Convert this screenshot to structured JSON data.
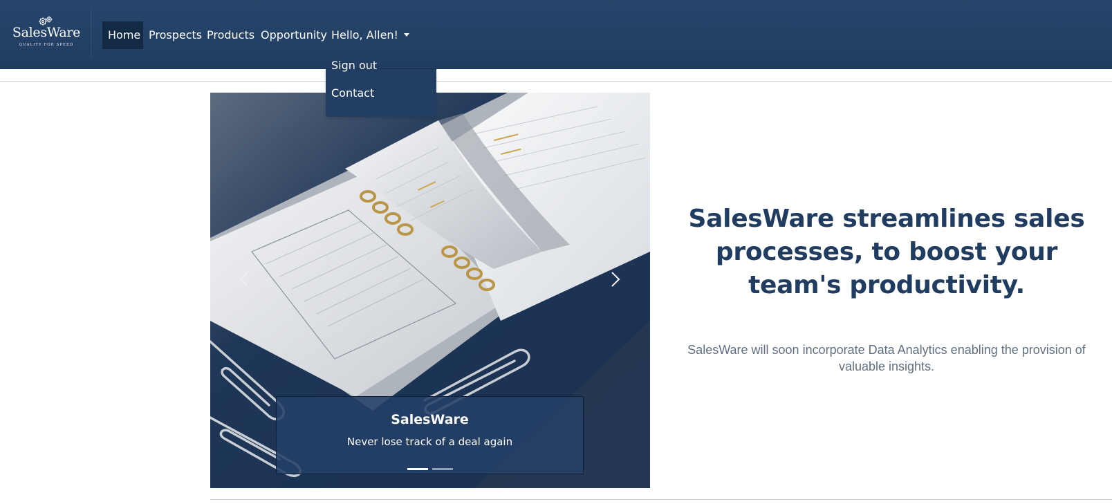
{
  "brand": {
    "name": "SalesWare",
    "tagline": "QUALITY FOR SPEED"
  },
  "nav": {
    "home": "Home",
    "prospects": "Prospects",
    "products": "Products",
    "opportunity": "Opportunity",
    "user_greeting": "Hello, Allen!",
    "active_item": "Home"
  },
  "user_menu": {
    "expanded": true,
    "items": [
      {
        "label": "Sign out"
      },
      {
        "label": "Contact"
      }
    ]
  },
  "carousel": {
    "image_alt": "Open planner notebook with gold rings and paper clips",
    "caption_title": "SalesWare",
    "caption_text": "Never lose track of a deal again",
    "slide_count": 2,
    "active_slide": 1
  },
  "hero": {
    "heading": "SalesWare streamlines sales processes, to boost your team's productivity.",
    "subtext": "SalesWare will soon incorporate Data Analytics enabling the provision of valuable insights."
  },
  "colors": {
    "navbar": "#233e63",
    "nav_active": "#132a45",
    "heading": "#203d61",
    "subtext": "#5f6f80"
  },
  "icons": {
    "logo": "gears-icon",
    "dropdown": "caret-down-icon",
    "prev": "chevron-left-icon",
    "next": "chevron-right-icon"
  }
}
